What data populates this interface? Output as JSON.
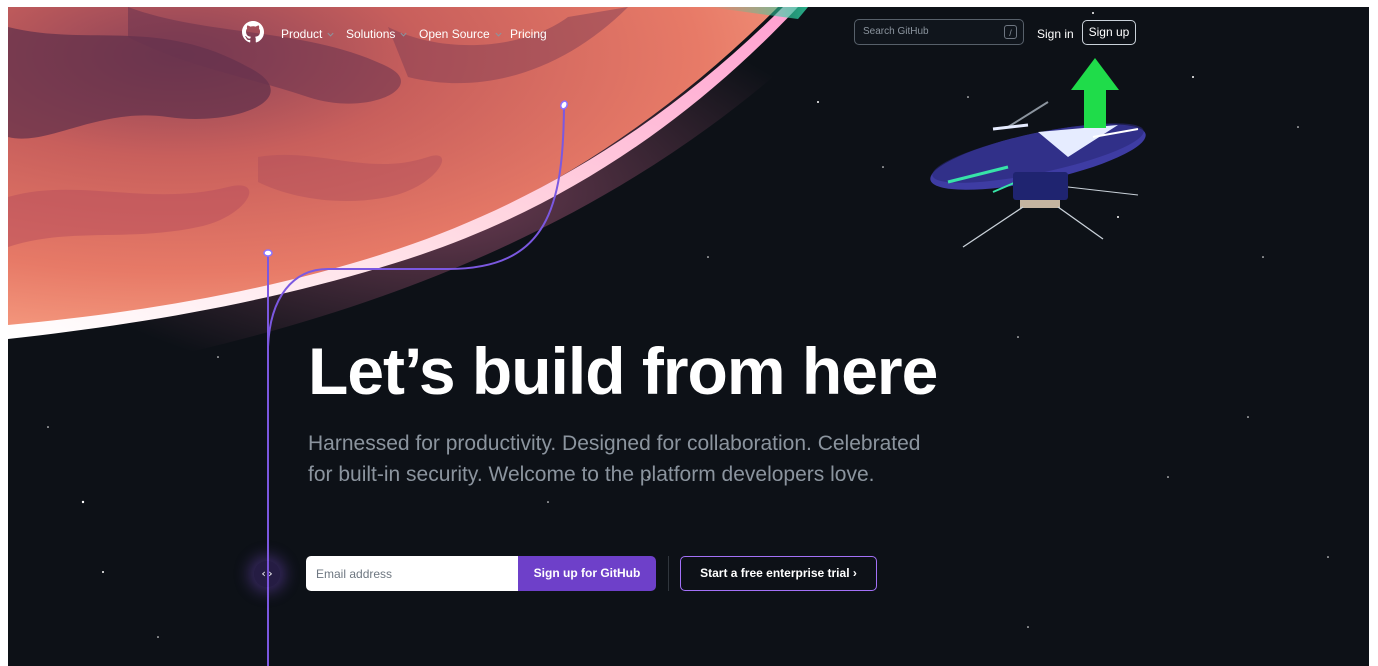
{
  "nav": {
    "items": [
      {
        "label": "Product",
        "has_dropdown": true
      },
      {
        "label": "Solutions",
        "has_dropdown": true
      },
      {
        "label": "Open Source",
        "has_dropdown": true
      },
      {
        "label": "Pricing",
        "has_dropdown": false
      }
    ],
    "search": {
      "placeholder": "Search GitHub",
      "shortcut": "/"
    },
    "sign_in": "Sign in",
    "sign_up": "Sign up"
  },
  "hero": {
    "title": "Let’s build from here",
    "subtitle": "Harnessed for productivity. Designed for collaboration. Celebrated for built-in security. Welcome to the platform developers love.",
    "email_placeholder": "Email address",
    "signup_button": "Sign up for GitHub",
    "trial_button": "Start a free enterprise trial ›",
    "code_icon": "‹›"
  },
  "icons": {
    "logo": "github-mark-icon",
    "chevron": "chevron-down-icon",
    "annotation_arrow": "green-up-arrow-icon"
  },
  "colors": {
    "background": "#0d1117",
    "accent": "#6e40c9",
    "trial_border": "#a371f7",
    "annotation_arrow": "#1fdc4a"
  }
}
